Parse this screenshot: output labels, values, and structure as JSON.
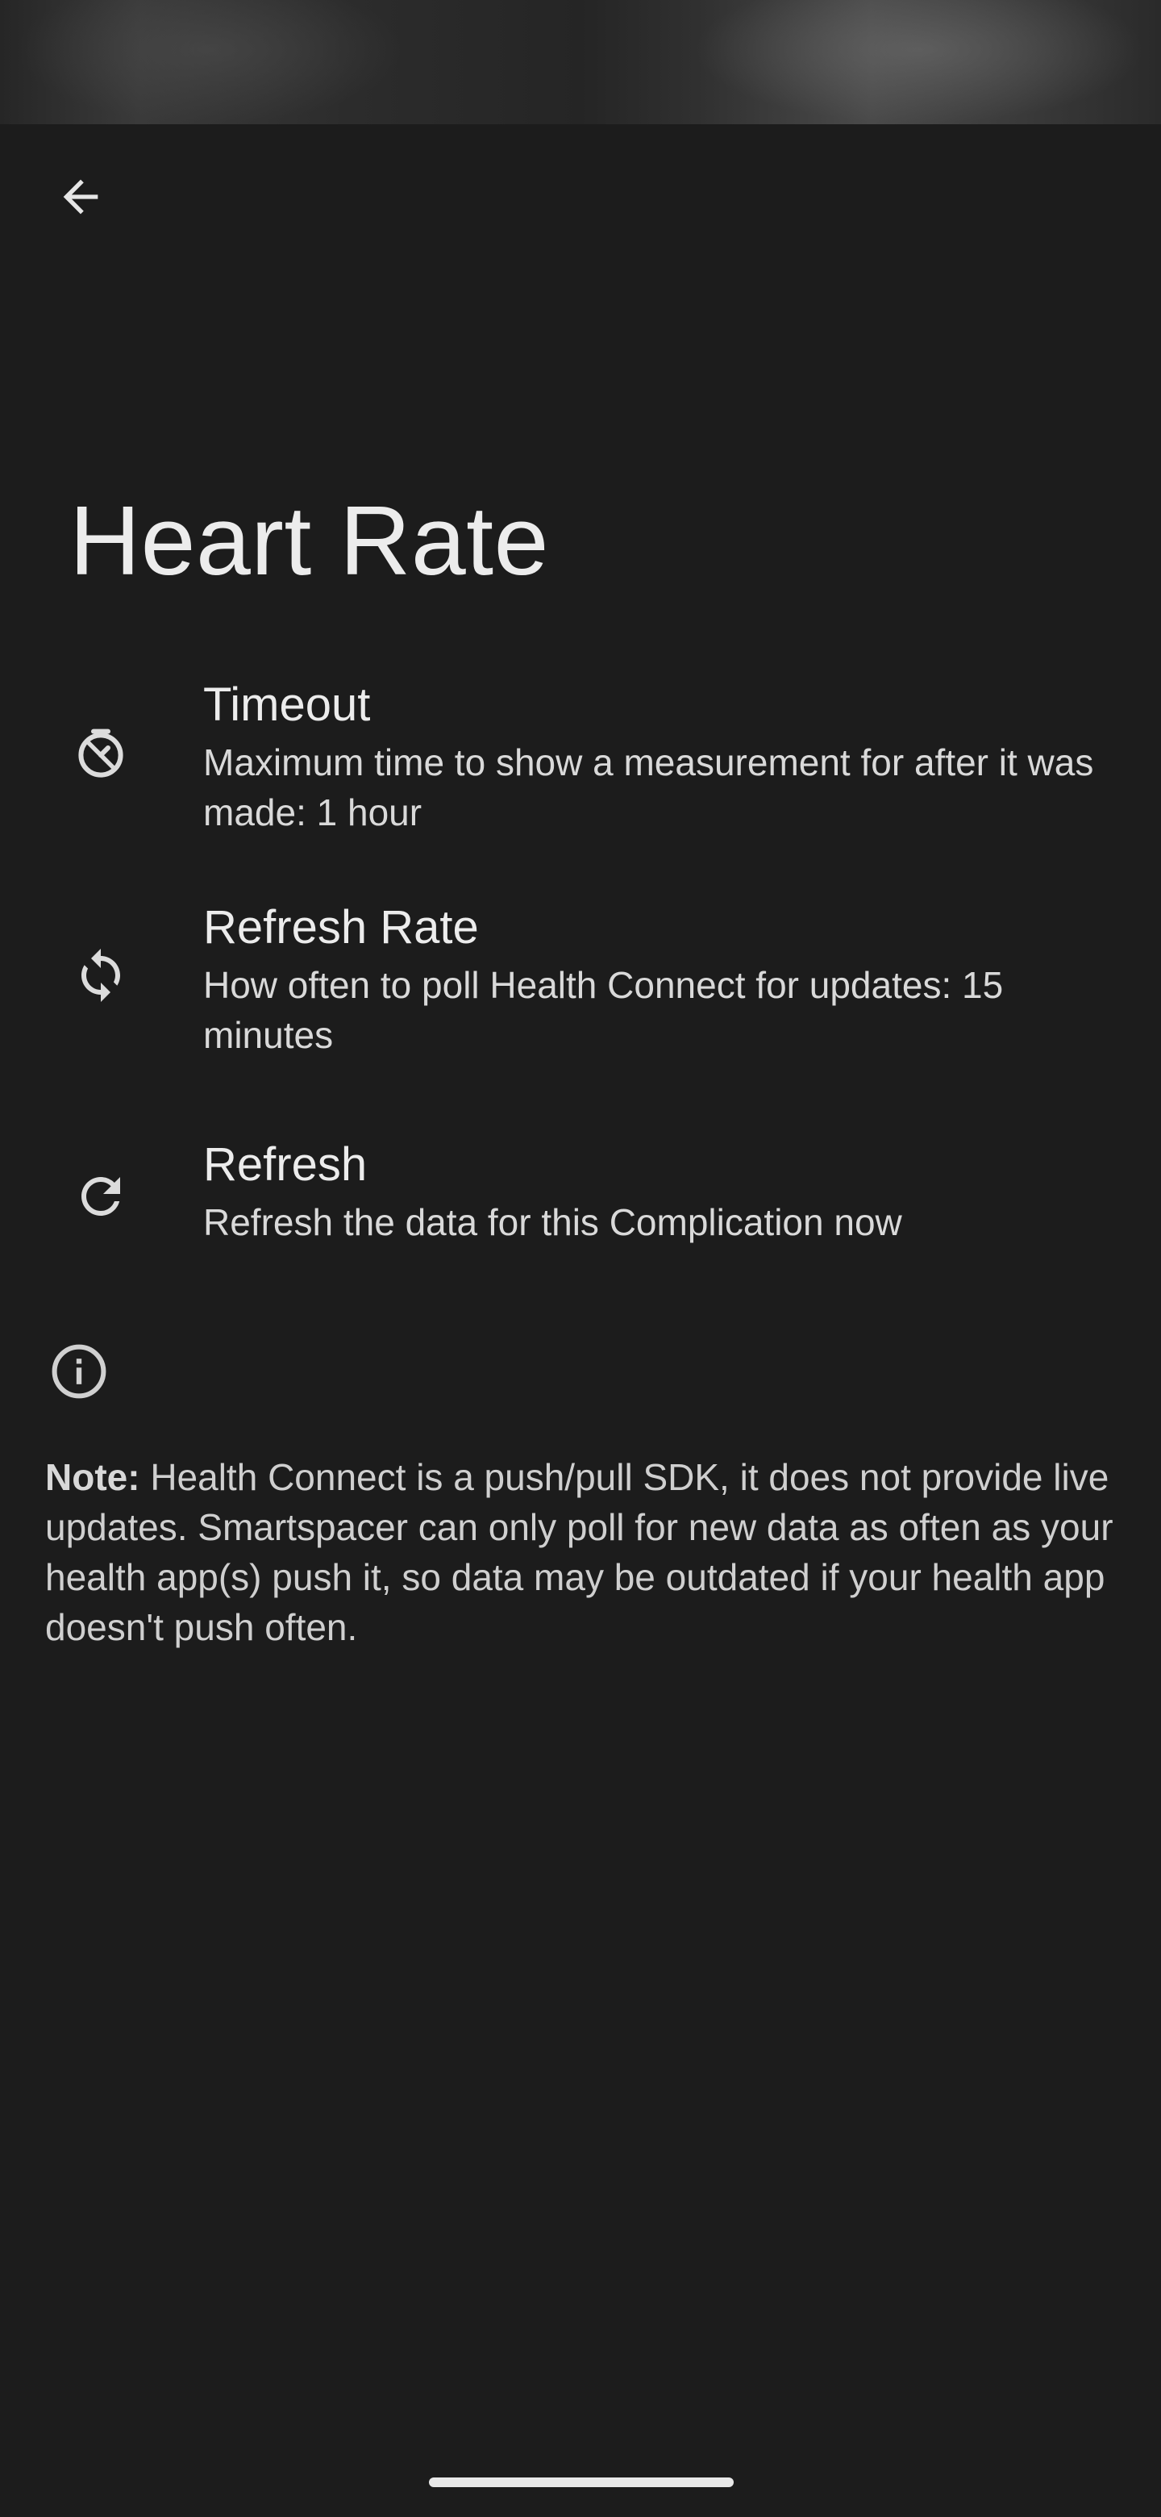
{
  "header": {
    "back_icon": "arrow-back-icon",
    "title": "Heart Rate"
  },
  "preferences": [
    {
      "icon": "timer-off-icon",
      "title": "Timeout",
      "summary": "Maximum time to show a measurement for after it was made: 1 hour"
    },
    {
      "icon": "sync-icon",
      "title": "Refresh Rate",
      "summary": "How often to poll Health Connect for updates: 15 minutes"
    },
    {
      "icon": "refresh-icon",
      "title": "Refresh",
      "summary": "Refresh the data for this Complication now"
    }
  ],
  "info": {
    "icon": "info-icon",
    "note_label": "Note:",
    "note_text": " Health Connect is a push/pull SDK, it does not provide live updates. Smartspacer can only poll for new data as often as your health app(s) push it, so data may be outdated if your health app doesn't push often."
  },
  "colors": {
    "background": "#1c1c1c",
    "text_primary": "#ececec",
    "text_secondary": "#d9d9d9"
  }
}
